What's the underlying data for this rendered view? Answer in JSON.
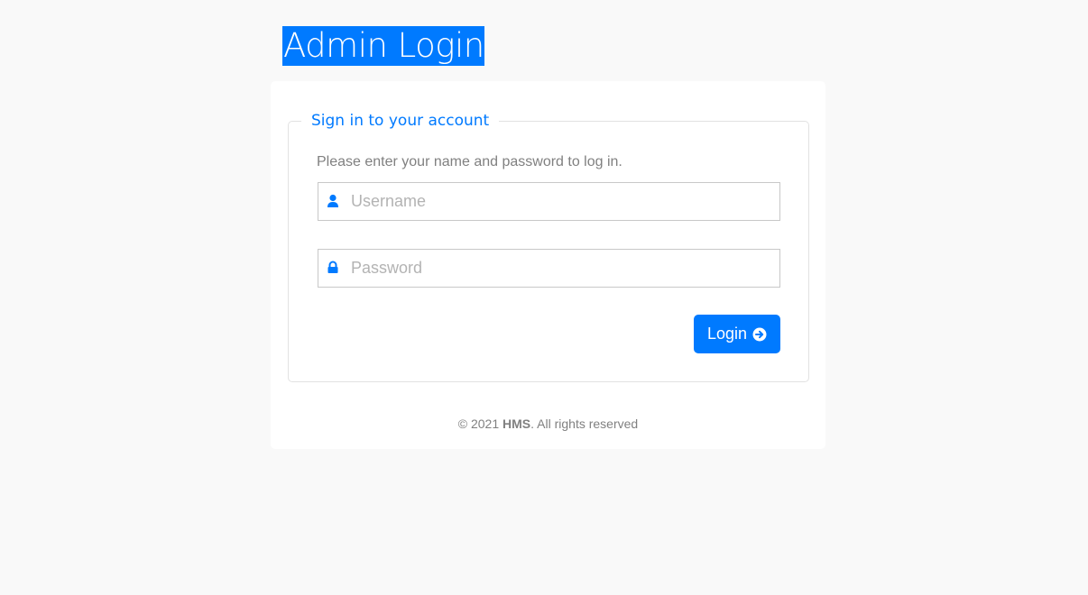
{
  "page_title": "Admin Login",
  "form": {
    "legend": "Sign in to your account",
    "instructions": "Please enter your name and password to log in.",
    "username": {
      "placeholder": "Username",
      "value": "",
      "icon": "user-icon"
    },
    "password": {
      "placeholder": "Password",
      "value": "",
      "icon": "lock-icon"
    },
    "login_label": "Login",
    "login_icon": "arrow-circle-right-icon"
  },
  "footer": {
    "prefix": "© 2021 ",
    "brand": "HMS",
    "suffix": ". All rights reserved"
  },
  "colors": {
    "accent": "#007aff",
    "background": "#f9f9f9",
    "muted_text": "#808080"
  }
}
